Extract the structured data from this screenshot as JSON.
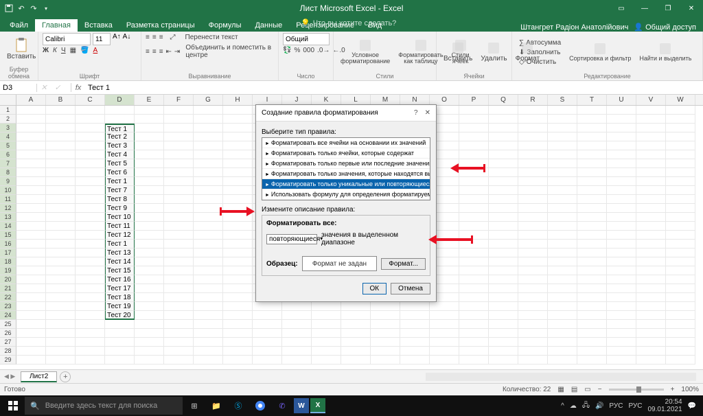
{
  "app": {
    "title": "Лист Microsoft Excel - Excel"
  },
  "user": "Штангрет Радіон Анатолійович",
  "share": "Общий доступ",
  "tabs": [
    "Файл",
    "Главная",
    "Вставка",
    "Разметка страницы",
    "Формулы",
    "Данные",
    "Рецензирование",
    "Вид"
  ],
  "active_tab": 1,
  "tell_me": "Что вы хотите сделать?",
  "ribbon": {
    "clipboard": {
      "label": "Буфер обмена",
      "paste": "Вставить"
    },
    "font": {
      "label": "Шрифт",
      "name": "Calibri",
      "size": "11"
    },
    "alignment": {
      "label": "Выравнивание",
      "wrap": "Перенести текст",
      "merge": "Объединить и поместить в центре"
    },
    "number": {
      "label": "Число",
      "format": "Общий"
    },
    "styles": {
      "label": "Стили",
      "cond": "Условное форматирование",
      "table": "Форматировать как таблицу",
      "cell": "Стили ячеек"
    },
    "cells": {
      "label": "Ячейки",
      "insert": "Вставить",
      "delete": "Удалить",
      "format": "Формат"
    },
    "editing": {
      "label": "Редактирование",
      "autosum": "Автосумма",
      "fill": "Заполнить",
      "clear": "Очистить",
      "sort": "Сортировка и фильтр",
      "find": "Найти и выделить"
    }
  },
  "name_box": "D3",
  "formula": "Тест 1",
  "columns": [
    "A",
    "B",
    "C",
    "D",
    "E",
    "F",
    "G",
    "H",
    "I",
    "J",
    "K",
    "L",
    "M",
    "N",
    "O",
    "P",
    "Q",
    "R",
    "S",
    "T",
    "U",
    "V",
    "W"
  ],
  "data_col_values": [
    "Тест 1",
    "Тест 2",
    "Тест 3",
    "Тест 4",
    "Тест 5",
    "Тест 6",
    "Тест 1",
    "Тест 7",
    "Тест 8",
    "Тест 9",
    "Тест 10",
    "Тест 11",
    "Тест 12",
    "Тест 1",
    "Тест 13",
    "Тест 14",
    "Тест 15",
    "Тест 16",
    "Тест 17",
    "Тест 18",
    "Тест 19",
    "Тест 20"
  ],
  "row_count": 29,
  "sheet_tab": "Лист2",
  "status": {
    "ready": "Готово",
    "count_label": "Количество:",
    "count": "22",
    "zoom": "100%"
  },
  "dialog": {
    "title": "Создание правила форматирования",
    "select_rule": "Выберите тип правила:",
    "rules": [
      "Форматировать все ячейки на основании их значений",
      "Форматировать только ячейки, которые содержат",
      "Форматировать только первые или последние значения",
      "Форматировать только значения, которые находятся выше или ниже среднего",
      "Форматировать только уникальные или повторяющиеся значения",
      "Использовать формулу для определения форматируемых ячеек"
    ],
    "selected_rule": 4,
    "edit_desc": "Измените описание правила:",
    "format_all": "Форматировать все:",
    "dup_option": "повторяющиеся",
    "range_text": "значения в выделенном диапазоне",
    "sample": "Образец:",
    "no_format": "Формат не задан",
    "format_btn": "Формат...",
    "ok": "ОК",
    "cancel": "Отмена"
  },
  "taskbar": {
    "search": "Введите здесь текст для поиска",
    "lang1": "РУС",
    "lang2": "РУС",
    "time": "20:54",
    "date": "09.01.2021"
  }
}
